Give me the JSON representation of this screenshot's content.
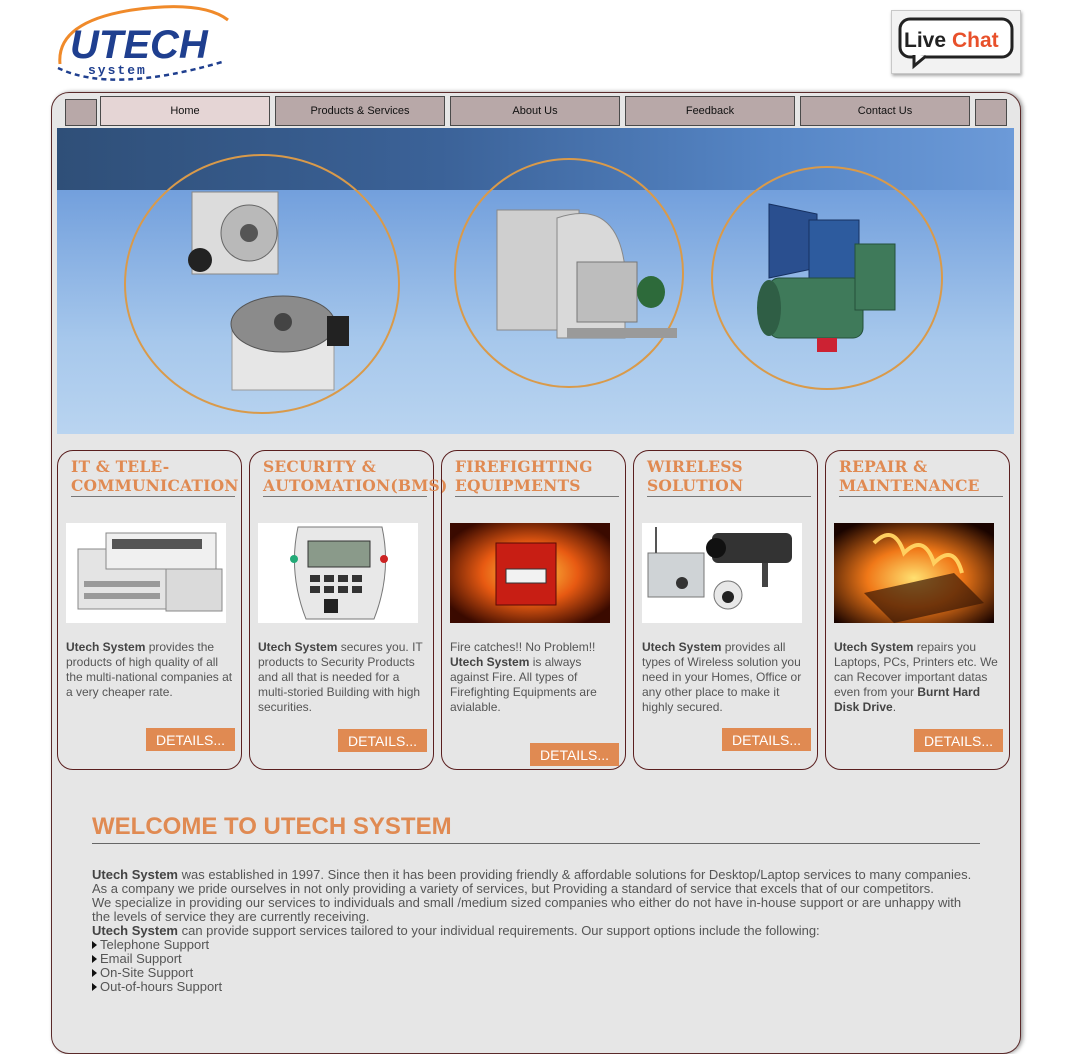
{
  "header": {
    "logo_text": "UTECH",
    "logo_sub": "system",
    "livechat_live": "Live",
    "livechat_chat": "Chat"
  },
  "nav": {
    "items": [
      "Home",
      "Products & Services",
      "About Us",
      "Feedback",
      "Contact Us"
    ],
    "active": "Home"
  },
  "services": [
    {
      "title": "IT & TELE-COMMUNICATION",
      "title_line1": "IT & TELE-",
      "title_line2": "COMMUNICATION",
      "brand": "Utech System",
      "text": " provides the products of high quality of all the multi-national companies at a very cheaper rate.",
      "button": "DETAILS..."
    },
    {
      "title_line1": "SECURITY &",
      "title_line2": "AUTOMATION(BMS)",
      "brand": "Utech System",
      "text": " secures you. IT products to Security Products and all that is needed for a multi-storied Building with high securities.",
      "button": "DETAILS..."
    },
    {
      "title_line1": "FIREFIGHTING",
      "title_line2": "EQUIPMENTS",
      "lead": "Fire catches!! No Problem!!",
      "brand": "Utech System",
      "text": " is always against Fire. All types of Firefighting Equipments are avialable.",
      "button": "DETAILS..."
    },
    {
      "title_line1": "WIRELESS",
      "title_line2": "SOLUTION",
      "brand": "Utech System",
      "text": " provides all types of Wireless solution you need in your Homes, Office or any other place to make it highly secured.",
      "button": "DETAILS..."
    },
    {
      "title_line1": "REPAIR &",
      "title_line2": "MAINTENANCE",
      "brand": "Utech System",
      "text": " repairs you Laptops, PCs, Printers etc. We can Recover important datas even from your ",
      "bold2": "Burnt Hard Disk Drive",
      "tail": ".",
      "button": "DETAILS..."
    }
  ],
  "welcome": {
    "heading": "WELCOME TO UTECH SYSTEM",
    "brand": "Utech System",
    "p1": " was established in 1997. Since then it has been providing friendly & affordable solutions for Desktop/Laptop services to many companies.",
    "p2": "As a company we pride ourselves in not only providing a variety of services, but Providing a standard of service that excels that of our competitors.",
    "p3": "We specialize in providing our services to individuals and small /medium sized companies who either do not have in-house support or are unhappy with the levels of service they are currently receiving.",
    "p4": " can provide support services tailored to your individual requirements. Our support options include the following:",
    "options": [
      "Telephone Support",
      "Email Support",
      "On-Site Support",
      "Out-of-hours Support"
    ]
  },
  "colors": {
    "accent": "#e08a52",
    "nav_bg": "#b8a8a8",
    "frame_bg": "#e6e6e6",
    "logo_blue": "#1f3f8f"
  }
}
